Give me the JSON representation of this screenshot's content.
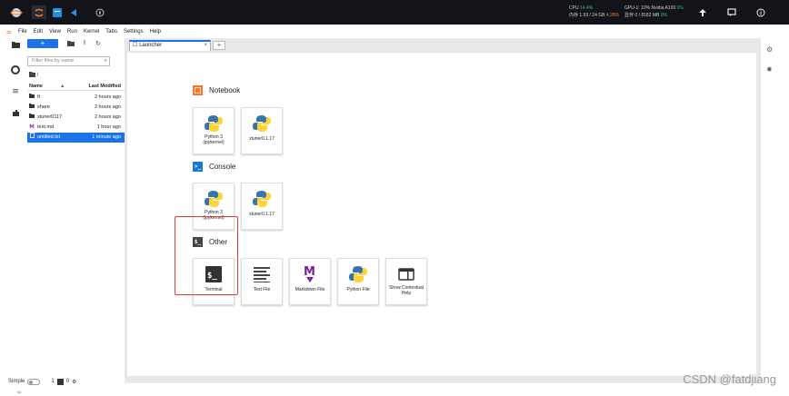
{
  "topbar": {
    "icons": [
      "jupyter-logo-icon",
      "jupyter-app-icon",
      "vscode-icon",
      "vscode-blue-icon",
      "compass-icon"
    ],
    "cpu": {
      "label": "CPU",
      "value": "14.4%"
    },
    "mem": {
      "label": "内存",
      "value": "1.03 / 24 GB",
      "pct": "4.28%"
    },
    "gpu": {
      "label": "GPU-1: 10% Nvidia A100",
      "value": "0%"
    },
    "vram": {
      "label": "显存",
      "value": "0 / 8182 MB",
      "pct": "0%"
    }
  },
  "menu": {
    "items": [
      "File",
      "Edit",
      "View",
      "Run",
      "Kernel",
      "Tabs",
      "Settings",
      "Help"
    ]
  },
  "filebrowser": {
    "new_label": "+",
    "filter_placeholder": "Filter files by name",
    "breadcrumb": "/",
    "columns": {
      "name": "Name",
      "sort": "▲",
      "modified": "Last Modified"
    },
    "files": [
      {
        "icon": "folder",
        "name": "ft",
        "modified": "2 hours ago"
      },
      {
        "icon": "folder",
        "name": "share",
        "modified": "2 hours ago"
      },
      {
        "icon": "folder",
        "name": "xtuner0117",
        "modified": "2 hours ago"
      },
      {
        "icon": "markdown",
        "name": "test.md",
        "modified": "1 hour ago"
      },
      {
        "icon": "text",
        "name": "untitled.txt",
        "modified": "1 minute ago"
      }
    ]
  },
  "tabs": {
    "launcher": "Launcher",
    "add": "+"
  },
  "launcher": {
    "notebook": {
      "title": "Notebook",
      "cards": [
        {
          "label": "Python 3 (ipykernel)"
        },
        {
          "label": "xtuner0.1.17"
        }
      ]
    },
    "console": {
      "title": "Console",
      "cards": [
        {
          "label": "Python 3 (ipykernel)"
        },
        {
          "label": "xtuner0.1.17"
        }
      ]
    },
    "other": {
      "title": "Other",
      "cards": [
        {
          "label": "Terminal"
        },
        {
          "label": "Text File"
        },
        {
          "label": "Markdown File"
        },
        {
          "label": "Python File"
        },
        {
          "label": "Show Contextual Help"
        }
      ]
    }
  },
  "statusbar": {
    "mode": "Simple",
    "count1": "1",
    "count2": "0"
  },
  "watermark": "CSDN @fatdjiang",
  "colors": {
    "accent": "#1a73e8",
    "topbar": "#131419",
    "jupyter": "#f37726",
    "highlight": "#e53935"
  }
}
